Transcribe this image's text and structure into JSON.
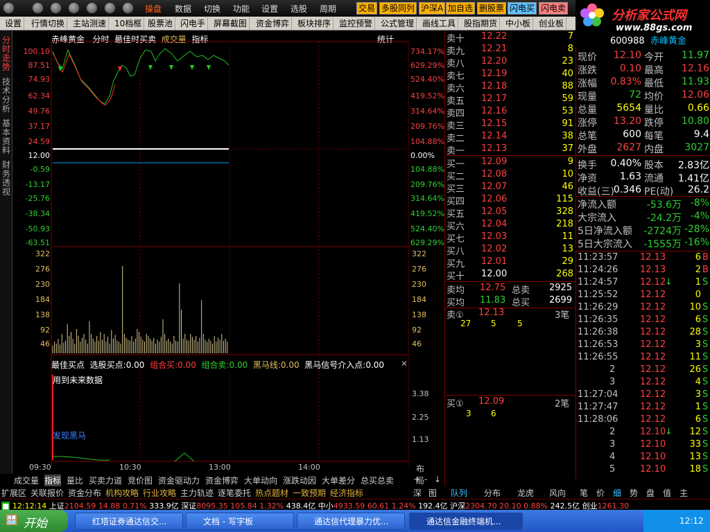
{
  "menubar": {
    "items": [
      "操盘",
      "数据",
      "切换",
      "功能",
      "设置",
      "选股",
      "周期"
    ],
    "quick": [
      "交易",
      "多股同列",
      "沪深A",
      "加自选",
      "删股票",
      "闪电买",
      "闪电卖"
    ]
  },
  "toolbar": [
    "设置",
    "行情切换",
    "主站测速",
    "10档框",
    "股票池",
    "闪电手",
    "屏幕截图",
    "资金博弈",
    "板块排序",
    "监控预警",
    "公式管理",
    "画线工具",
    "股指期货",
    "中小板",
    "创业板"
  ],
  "logo": {
    "text": "分析家公式网",
    "url": "www.88gs.com"
  },
  "left_tabs": [
    "分时走势",
    "技术分析",
    "基本资料",
    "财务透视"
  ],
  "chart": {
    "header": {
      "name": "赤峰黄金",
      "mode": "分时",
      "indicator": "最佳时买卖",
      "vol": "成交量",
      "idx": "指标",
      "stat": "统计"
    },
    "price_left": [
      "100.10",
      "87.51",
      "74.93",
      "62.34",
      "49.76",
      "37.17",
      "24.59",
      "12.00",
      "-0.59",
      "-13.17",
      "-25.76",
      "-38.34",
      "-50.93",
      "-63.51"
    ],
    "price_right": [
      "734.17%",
      "629.29%",
      "524.40%",
      "419.52%",
      "314.64%",
      "209.76%",
      "104.88%",
      "0.00%",
      "104.88%",
      "209.76%",
      "314.64%",
      "419.52%",
      "524.40%",
      "629.29%"
    ],
    "vol_left": [
      "322",
      "276",
      "230",
      "184",
      "138",
      "92",
      "46"
    ],
    "vol_right": [
      "322",
      "276",
      "230",
      "184",
      "138",
      "92",
      "46"
    ],
    "indicator_line": {
      "a": "最佳买点",
      "b": "选股买点:",
      "b_v": "0.00",
      "c": "组合买:",
      "c_v": "0.00",
      "d": "组合卖:",
      "d_v": "0.00",
      "e": "黑马线:",
      "e_v": "0.00",
      "f": "黑马信号介入点:",
      "f_v": "0.00"
    },
    "ind_note": "用到未来数据",
    "ind_label": "发现黑马",
    "ind_axis": [
      "3.38",
      "2.25",
      "1.13"
    ],
    "times": [
      "09:30",
      "10:30",
      "13:00",
      "14:00"
    ],
    "layout_label": "布局",
    "volumes": [
      0.08,
      0.12,
      0.1,
      0.15,
      0.09,
      0.2,
      0.11,
      0.13,
      0.3,
      0.18,
      0.22,
      0.15,
      0.1,
      0.25,
      0.18,
      0.12,
      0.16,
      0.2,
      0.14,
      0.1,
      0.33,
      0.2,
      0.15,
      0.12,
      0.18,
      0.13,
      0.22,
      0.14,
      0.2,
      0.12,
      0.17,
      0.1,
      0.24,
      0.15,
      0.19,
      0.13,
      0.12,
      0.1,
      0.9,
      0.2,
      0.16,
      0.14,
      0.13,
      0.18,
      0.12,
      0.15,
      0.25,
      0.22,
      0.17,
      0.14,
      0.12,
      0.2,
      0.18,
      0.15,
      0.13,
      0.16,
      0.1,
      0.14,
      0.12,
      0.17,
      0.35,
      0.2,
      0.13,
      0.15,
      0.12,
      0.1,
      0.18,
      0.13,
      0.12,
      0.72,
      0.45,
      0.15,
      0.2,
      0.14,
      0.13,
      0.2,
      0.17,
      0.14,
      0.18,
      0.12,
      0.16,
      0.55,
      0.2,
      0.14,
      0.12,
      0.15,
      0.13,
      0.1,
      0.18,
      0.12,
      0.16,
      0.14,
      0.2,
      0.13,
      0.15,
      0.12
    ]
  },
  "book": {
    "sell": [
      [
        "卖十",
        "12.22",
        "7"
      ],
      [
        "卖九",
        "12.21",
        "8"
      ],
      [
        "卖八",
        "12.20",
        "23"
      ],
      [
        "卖七",
        "12.19",
        "40"
      ],
      [
        "卖六",
        "12.18",
        "88"
      ],
      [
        "卖五",
        "12.17",
        "59"
      ],
      [
        "卖四",
        "12.16",
        "53"
      ],
      [
        "卖三",
        "12.15",
        "91"
      ],
      [
        "卖二",
        "12.14",
        "38"
      ],
      [
        "卖一",
        "12.13",
        "37"
      ]
    ],
    "buy": [
      [
        "买一",
        "12.09",
        "9"
      ],
      [
        "买二",
        "12.08",
        "10"
      ],
      [
        "买三",
        "12.07",
        "46"
      ],
      [
        "买四",
        "12.06",
        "115"
      ],
      [
        "买五",
        "12.05",
        "328"
      ],
      [
        "买六",
        "12.04",
        "218"
      ],
      [
        "买七",
        "12.03",
        "11"
      ],
      [
        "买八",
        "12.02",
        "13"
      ],
      [
        "买九",
        "12.01",
        "29"
      ],
      [
        "买十",
        "12.00",
        "268"
      ]
    ],
    "avg_sell_label": "卖均",
    "avg_sell": "12.75",
    "total_sell_label": "总卖",
    "total_sell": "2925",
    "avg_buy_label": "买均",
    "avg_buy": "11.83",
    "total_buy_label": "总买",
    "total_buy": "2699",
    "sell1_label": "卖①",
    "sell1_price": "12.13",
    "sell1_cnt": "3笔",
    "sell1_q": [
      "27",
      "5",
      "5"
    ],
    "buy1_label": "买①",
    "buy1_price": "12.09",
    "buy1_cnt": "2笔",
    "buy1_q": [
      "3",
      "6"
    ]
  },
  "quote": {
    "code": "600988",
    "name": "赤峰黄金",
    "rows": [
      [
        "现价",
        "12.10",
        "今开",
        "11.97"
      ],
      [
        "涨跌",
        "0.10",
        "最高",
        "12.16"
      ],
      [
        "涨幅",
        "0.83%",
        "最低",
        "11.93"
      ],
      [
        "现量",
        "72",
        "均价",
        "12.06"
      ],
      [
        "总量",
        "5654",
        "量比",
        "0.66"
      ],
      [
        "涨停",
        "13.20",
        "跌停",
        "10.80"
      ],
      [
        "总笔",
        "600",
        "每笔",
        "9.4"
      ],
      [
        "外盘",
        "2627",
        "内盘",
        "3027"
      ],
      [
        "换手",
        "0.40%",
        "股本",
        "2.83亿"
      ],
      [
        "净资",
        "1.63",
        "流通",
        "1.41亿"
      ],
      [
        "收益(三)",
        "0.346",
        "PE(动)",
        "26.2"
      ]
    ],
    "flows": [
      [
        "净流入额",
        "-53.6万",
        "-8%"
      ],
      [
        "大宗流入",
        "-24.2万",
        "-4%"
      ],
      [
        "5日净流入额",
        "-2724万",
        "-28%"
      ],
      [
        "5日大宗流入",
        "-1555万",
        "-16%"
      ]
    ]
  },
  "ticks": [
    [
      "11:23:57",
      "12.13",
      "6",
      "B",
      ""
    ],
    [
      "11:24:26",
      "12.13",
      "2",
      "B",
      ""
    ],
    [
      "11:24:57",
      "12.12",
      "1",
      "S",
      "↓"
    ],
    [
      "11:25:52",
      "12.12",
      "0",
      "",
      ""
    ],
    [
      "11:26:29",
      "12.12",
      "10",
      "S",
      ""
    ],
    [
      "11:26:35",
      "12.12",
      "6",
      "S",
      ""
    ],
    [
      "11:26:38",
      "12.12",
      "28",
      "S",
      ""
    ],
    [
      "11:26:53",
      "12.12",
      "3",
      "S",
      ""
    ],
    [
      "11:26:55",
      "12.12",
      "11",
      "S",
      ""
    ],
    [
      "2",
      "12.12",
      "26",
      "S",
      ""
    ],
    [
      "3",
      "12.12",
      "4",
      "S",
      ""
    ],
    [
      "11:27:04",
      "12.12",
      "3",
      "S",
      ""
    ],
    [
      "11:27:47",
      "12.12",
      "1",
      "S",
      ""
    ],
    [
      "11:28:06",
      "12.12",
      "6",
      "S",
      ""
    ],
    [
      "2",
      "12.10",
      "12",
      "S",
      "↓"
    ],
    [
      "3",
      "12.10",
      "33",
      "S",
      ""
    ],
    [
      "4",
      "12.10",
      "13",
      "S",
      ""
    ],
    [
      "5",
      "12.10",
      "18",
      "S",
      ""
    ]
  ],
  "btabs": [
    "成交量",
    "指标",
    "量比",
    "买卖力道",
    "竞价图",
    "资金驱动力",
    "资金博弈",
    "大单动向",
    "涨跌动因",
    "大单差分",
    "总买总卖"
  ],
  "btabs2": [
    "扩展区",
    "关联报价",
    "资金分布",
    "机构攻略",
    "行业攻略",
    "主力轨迹",
    "逐笔委托",
    "热点题材",
    "一致预期",
    "经济指标"
  ],
  "book_tabs": [
    "深",
    "图",
    "队列",
    "分布",
    "龙虎",
    "风向"
  ],
  "tick_tabs": [
    "笔",
    "价",
    "细",
    "势",
    "盘",
    "值",
    "主"
  ],
  "status": {
    "time": "12:12:14",
    "sh": "上证",
    "sh_v": "2104.59",
    "sh_c": "14.88",
    "sh_p": "0.71%",
    "sh_a": "333.9亿",
    "sz": "深证",
    "sz_v": "8095.35",
    "sz_c": "105.84",
    "sz_p": "1.32%",
    "sz_a": "438.4亿",
    "zx": "中小",
    "zx_v": "4933.59",
    "zx_c": "60.61",
    "zx_p": "1.24%",
    "zx_a": "192.4亿",
    "hs": "沪深",
    "hs_v": "2304.70",
    "hs_c": "20.10",
    "hs_p": "0.88%",
    "hs_a": "242.5亿",
    "cy": "创业",
    "cy_v": "1261.30"
  },
  "taskbar": {
    "start": "开始",
    "tasks": [
      "红塔证券通达信交...",
      "文档 - 写字板",
      "通达信代理暴力优...",
      "通达信金融终端机..."
    ],
    "clock": "12:12"
  }
}
